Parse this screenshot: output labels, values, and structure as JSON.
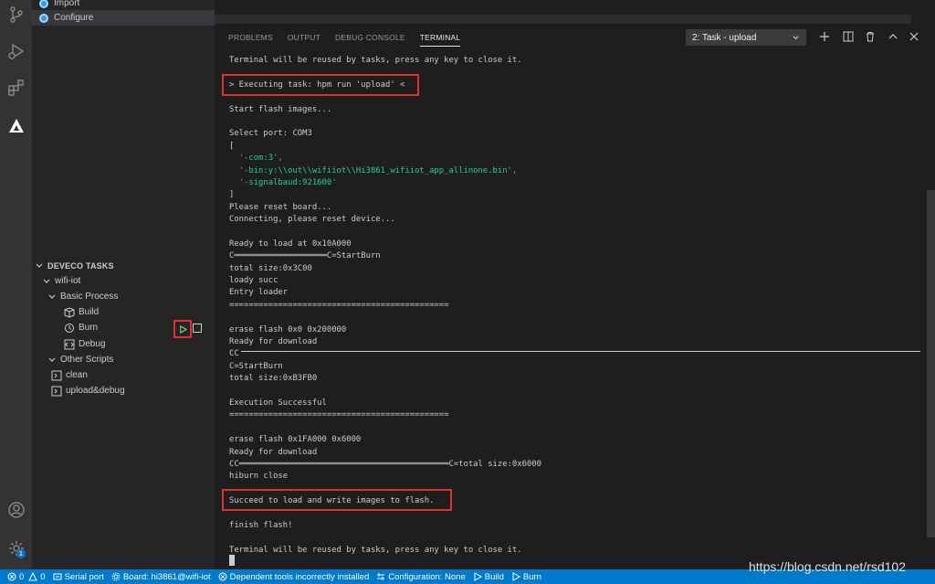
{
  "sidebar": {
    "top_items": [
      {
        "label": "Import"
      },
      {
        "label": "Configure"
      }
    ],
    "section_title": "DEVECO TASKS",
    "tree": {
      "project": "wifi-iot",
      "basic_process": "Basic Process",
      "build": "Build",
      "burn": "Burn",
      "debug": "Debug",
      "other_scripts": "Other Scripts",
      "clean": "clean",
      "upload_debug": "upload&debug"
    }
  },
  "activity_bar": {
    "icons": [
      "source-control-icon",
      "run-debug-icon",
      "extensions-icon",
      "deveco-icon",
      "account-icon",
      "settings-icon"
    ],
    "settings_badge": "1"
  },
  "panel": {
    "tabs": [
      "PROBLEMS",
      "OUTPUT",
      "DEBUG CONSOLE",
      "TERMINAL"
    ],
    "active_tab": "TERMINAL",
    "task_select": "2: Task - upload",
    "terminal_lines": [
      "Terminal will be reused by tasks, press any key to close it.",
      "",
      "> Executing task: hpm run 'upload' <",
      "",
      "Start flash images...",
      "",
      "Select port: COM3",
      "[",
      "  '-com:3',",
      "  '-bin:y:\\\\out\\\\wifiiot\\\\Hi3861_wifiiot_app_allinone.bin',",
      "  '-signalbaud:921600'",
      "]",
      "Please reset board...",
      "Connecting, please reset device...",
      "",
      "Ready to load at 0x10A000",
      "C═══════════════════C=StartBurn",
      "total size:0x3C00",
      "loady succ",
      "Entry loader",
      "=============================================",
      "",
      "erase flash 0x0 0x200000",
      "Ready for download",
      "CC",
      "C=StartBurn",
      "total size:0xB3FB0",
      "",
      "Execution Successful",
      "=============================================",
      "",
      "erase flash 0x1FA000 0x6000",
      "Ready for download",
      "CC═══════════════════════════════════════════C=total size:0x6000",
      "hiburn close",
      "",
      "Succeed to load and write images to flash.",
      "",
      "finish flash!",
      "",
      "Terminal will be reused by tasks, press any key to close it."
    ]
  },
  "statusbar": {
    "errors": "0",
    "warnings": "0",
    "serial_port": "Serial port",
    "board": "Board: hi3861@wifi-iot",
    "dependent": "Dependent tools incorrectly installed",
    "configuration": "Configuration: None",
    "build": "Build",
    "burn": "Burn"
  },
  "watermark": "https://blog.csdn.net/rsd102",
  "colors": {
    "highlight_box": "#e03131",
    "statusbar": "#007acc",
    "string_green": "#23d18b"
  }
}
